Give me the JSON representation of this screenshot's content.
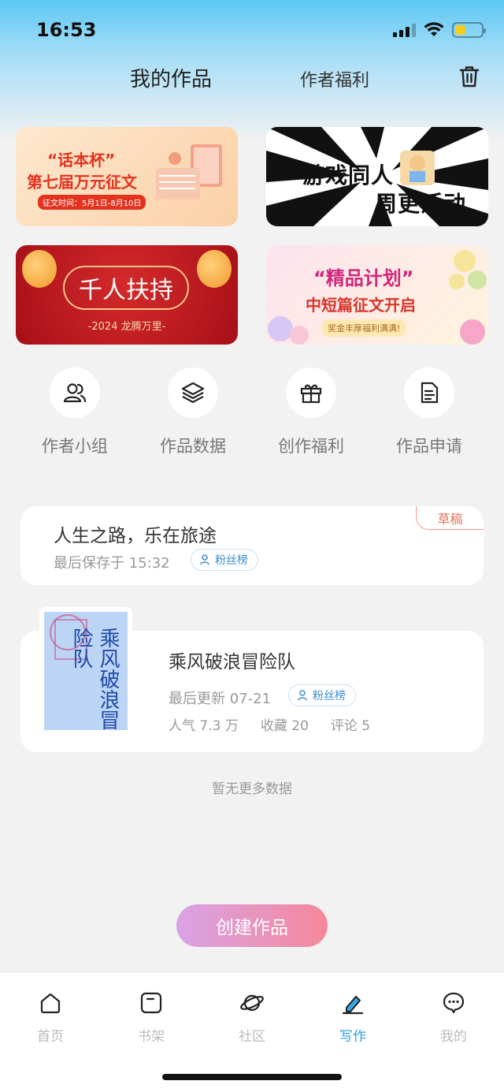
{
  "status_bar": {
    "time": "16:53"
  },
  "header": {
    "tab_my_works": "我的作品",
    "tab_author_welfare": "作者福利",
    "trash_icon": "trash-icon"
  },
  "banners": {
    "b1": {
      "title_line1": "“话本杯”",
      "title_line2": "第七届万元征文",
      "date": "征文时间：5月1日-8月10日"
    },
    "b2": {
      "line1": "游戏同人",
      "line2": "周更活动"
    },
    "b3": {
      "main": "千人扶持",
      "sub": "-2024 龙腾万里-"
    },
    "b4": {
      "title": "“精品计划”",
      "subtitle": "中短篇征文开启",
      "tag": "奖金丰厚福利满满!"
    }
  },
  "quick_actions": [
    {
      "label": "作者小组",
      "icon": "users-icon"
    },
    {
      "label": "作品数据",
      "icon": "layers-icon"
    },
    {
      "label": "创作福利",
      "icon": "gift-icon"
    },
    {
      "label": "作品申请",
      "icon": "document-icon"
    }
  ],
  "draft": {
    "badge": "草稿",
    "title": "人生之路，乐在旅途",
    "saved": "最后保存于 15:32",
    "fans": "粉丝榜"
  },
  "work": {
    "cover_text": "乘风破浪冒险队",
    "title": "乘风破浪冒险队",
    "updated": "最后更新 07-21",
    "fans": "粉丝榜",
    "popularity": "人气 7.3 万",
    "favorites": "收藏 20",
    "comments": "评论 5"
  },
  "no_more": "暂无更多数据",
  "create_button": "创建作品",
  "tabbar": [
    {
      "label": "首页",
      "icon": "home-icon",
      "active": false
    },
    {
      "label": "书架",
      "icon": "bookshelf-icon",
      "active": false
    },
    {
      "label": "社区",
      "icon": "planet-icon",
      "active": false
    },
    {
      "label": "写作",
      "icon": "pen-icon",
      "active": true
    },
    {
      "label": "我的",
      "icon": "chat-icon",
      "active": false
    }
  ],
  "colors": {
    "accent": "#2f9fe0",
    "draft_badge": "#e7735f",
    "create_start": "#d9a3e6",
    "create_end": "#f5889a"
  }
}
